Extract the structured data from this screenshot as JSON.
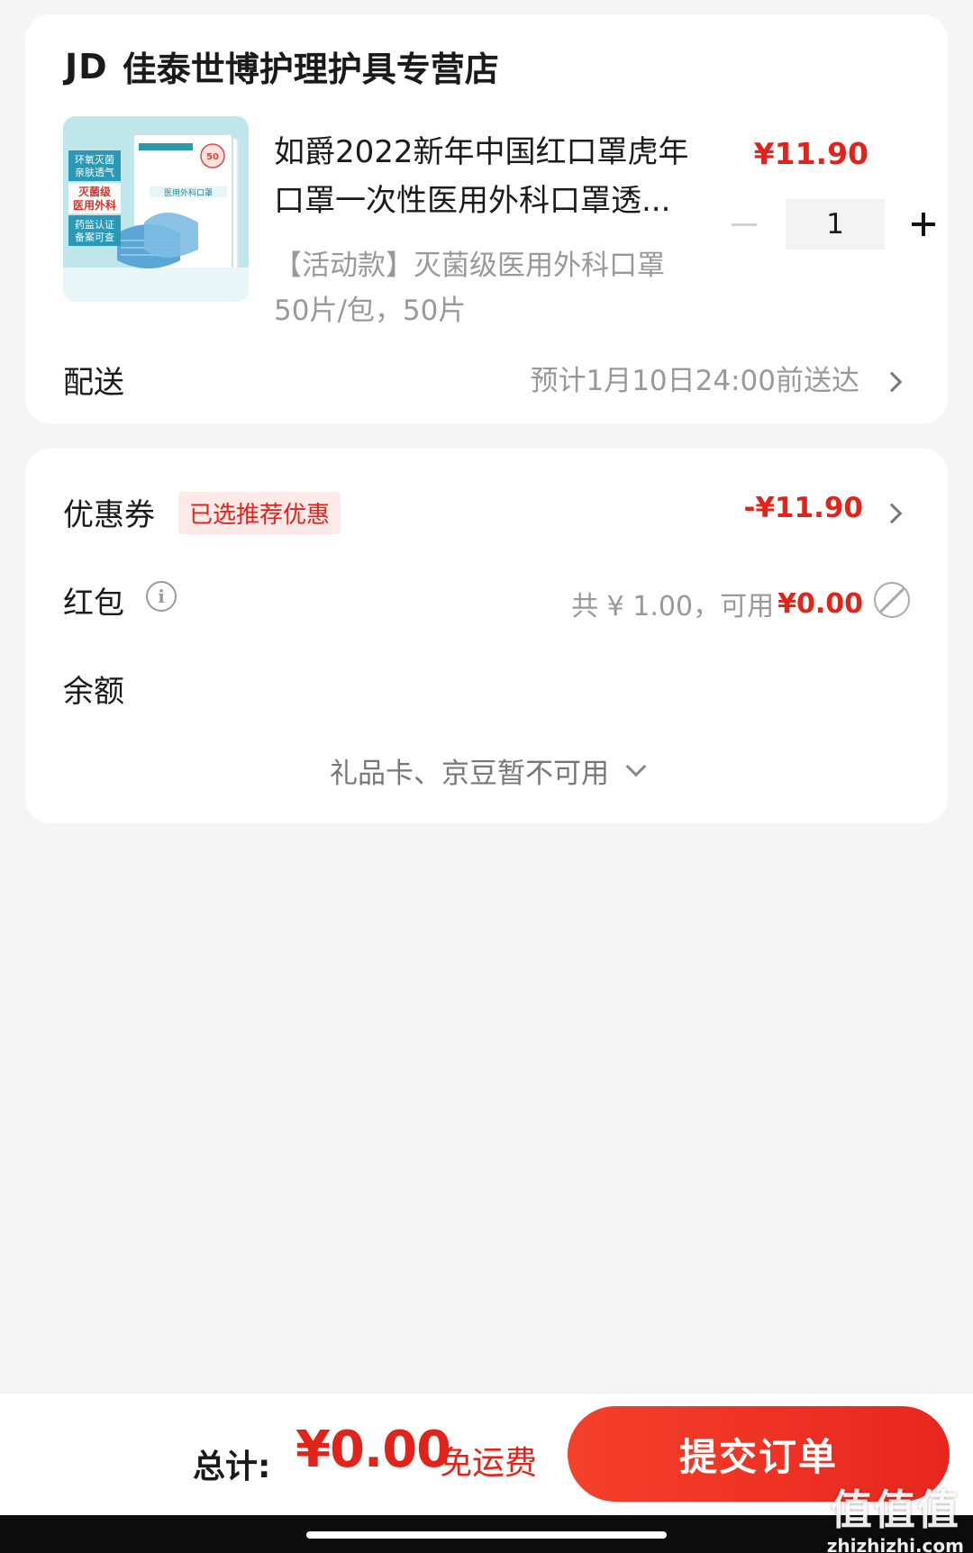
{
  "shop": {
    "logo": "JD",
    "name": "佳泰世博护理护具专营店"
  },
  "product": {
    "title": "如爵2022新年中国红口罩虎年口罩一次性医用外科口罩透...",
    "spec": "【活动款】灭菌级医用外科口罩 50片/包，50片",
    "price": "¥11.90",
    "quantity": "1",
    "image_text": {
      "badge1": "环氧灭菌",
      "badge2": "亲肤透气",
      "badge3": "灭菌级",
      "badge4": "医用外科",
      "badge5": "药监认证",
      "badge6": "备案可查",
      "pack_label": "医用外科口罩",
      "count": "50"
    }
  },
  "delivery": {
    "label": "配送",
    "value": "预计1月10日24:00前送达"
  },
  "coupon": {
    "label": "优惠券",
    "badge": "已选推荐优惠",
    "value": "-¥11.90"
  },
  "redpacket": {
    "label": "红包",
    "total": "共 ¥ 1.00，可用",
    "available": "¥0.00"
  },
  "balance": {
    "label": "余额"
  },
  "unavailable": {
    "text": "礼品卡、京豆暂不可用"
  },
  "footer": {
    "total_label": "总计:",
    "total_value": "¥0.00",
    "shipping": "免运费",
    "submit": "提交订单"
  },
  "watermark": {
    "big": "值值值",
    "small": "zhizhizhi.com"
  },
  "colors": {
    "accent": "#e2231a",
    "background": "#f5f5f5"
  }
}
